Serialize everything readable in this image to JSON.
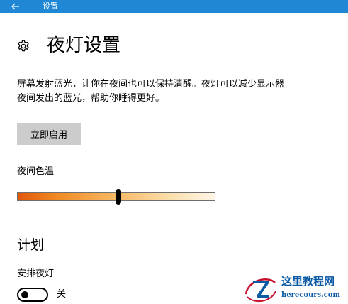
{
  "colors": {
    "accent": "#1f87d6",
    "button_bg": "#cccccc",
    "watermark_blue": "#0b5aa6",
    "watermark_red": "#c8102e"
  },
  "titlebar": {
    "back_icon": "arrow-left-icon",
    "title": "设置"
  },
  "page": {
    "icon": "gear-icon",
    "title": "夜灯设置",
    "description_lines": [
      "屏幕发射蓝光，让你在夜间也可以保持清醒。夜灯可以减少显示器",
      "夜间发出的蓝光，帮助你睡得更好。"
    ],
    "enable_button": "立即启用",
    "color_temp": {
      "label": "夜间色温",
      "value_fraction": 0.51
    }
  },
  "schedule": {
    "title": "计划",
    "label": "安排夜灯",
    "toggle_on": false,
    "toggle_state": "关"
  },
  "watermark": {
    "name": "这里教程网",
    "url": "herecours.com"
  }
}
